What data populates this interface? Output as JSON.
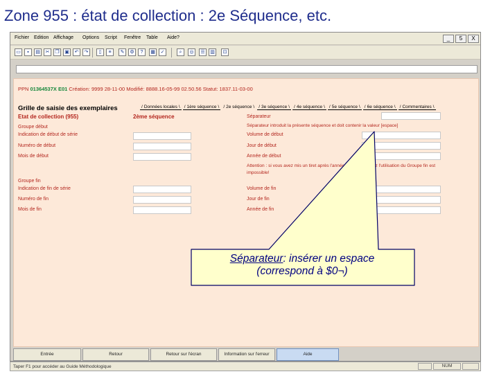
{
  "slide_title": "Zone 955 : état de collection :  2e Séquence, etc.",
  "menu": {
    "items": [
      "Fichier",
      "Edition",
      "Affichage",
      "Options",
      "Script",
      "Fenêtre",
      "Table",
      "Aide?"
    ],
    "window_buttons": [
      "_",
      "5",
      "X"
    ]
  },
  "toolbar": {
    "icons": [
      "folder-icon",
      "save-icon",
      "print-icon",
      "cut-icon",
      "copy-icon",
      "paste-icon",
      "undo-icon",
      "redo-icon",
      "doc-icon",
      "list-icon",
      "edit-icon",
      "tools-icon",
      "help-icon",
      "grid-icon",
      "check-icon",
      "search-icon",
      "zoom-icon"
    ]
  },
  "record": {
    "ppn_label": "PPN",
    "ppn_value": "01364537X E01",
    "meta": "Création: 9999 28-11-00 Modifié: 8888.16-05-99 02.50.56 Statut: 1837.11-03-00"
  },
  "grid": {
    "title": "Grille de saisie des exemplaires",
    "tabs": [
      {
        "label": "Données locales",
        "active": false
      },
      {
        "label": "1ère séquence",
        "active": false
      },
      {
        "label": "2e séquence",
        "active": true
      },
      {
        "label": "3e séquence",
        "active": false
      },
      {
        "label": "4e séquence",
        "active": false
      },
      {
        "label": "5e séquence",
        "active": false
      },
      {
        "label": "6e séquence",
        "active": false
      },
      {
        "label": "Commentaires",
        "active": false
      }
    ],
    "left_header": "Etat de collection (955)",
    "mid_header": "2ème séquence",
    "left_fields": {
      "groupe_debut": "Groupe début",
      "indic_debut": "Indication de début de série",
      "num_debut": "Numéro de début",
      "mois_debut": "Mois de début",
      "groupe_fin": "Groupe fin",
      "indic_fin": "Indication de fin de série",
      "num_fin": "Numéro de fin",
      "mois_fin": "Mois de fin"
    },
    "right_fields": {
      "separateur": "Séparateur",
      "sep_help": "Séparateur introduit la présente séquence et doit contenir la valeur [espace]",
      "vol_debut": "Volume de début",
      "jour_debut": "Jour de début",
      "annee_debut": "Année de début",
      "warning_1": "Attention : si vous avez mis un tiret après l'année de début, évitez l'utilisation du Groupe fin est",
      "warning_2": "impossible!",
      "vol_fin": "Volume de fin",
      "jour_fin": "Jour de fin",
      "annee_fin": "Année de fin"
    }
  },
  "buttons": [
    "Entrée",
    "Retour",
    "Retour sur l'écran",
    "Information sur l'erreur",
    "Aide"
  ],
  "status": {
    "text": "Taper F1 pour accéder au Guide Méthodologique",
    "mode": "NUM"
  },
  "callout": {
    "term": "Séparateur",
    "line1_rest": ": insérer un espace",
    "line2": "(correspond à $0¬)",
    "fill": "#ffffcc",
    "stroke": "#000066"
  },
  "colors": {
    "title": "#1f2d8c",
    "panel_bg": "#fde9d9",
    "label_red": "#b3261e",
    "ppn_green": "#16873a"
  }
}
